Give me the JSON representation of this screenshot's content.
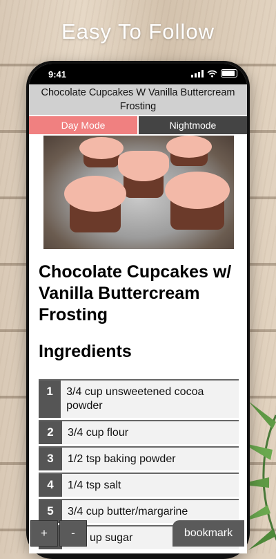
{
  "promo": {
    "headline": "Easy To Follow"
  },
  "status_bar": {
    "time": "9:41"
  },
  "app": {
    "title": "Chocolate Cupcakes W Vanilla Buttercream Frosting",
    "day_mode_label": "Day Mode",
    "night_mode_label": "Nightmode"
  },
  "recipe": {
    "title": "Chocolate Cupcakes w/ Vanilla Buttercream Frosting",
    "ingredients_heading": "Ingredients",
    "ingredients": [
      {
        "num": "1",
        "text": "3/4 cup unsweetened cocoa powder"
      },
      {
        "num": "2",
        "text": "3/4 cup flour"
      },
      {
        "num": "3",
        "text": "1/2 tsp baking powder"
      },
      {
        "num": "4",
        "text": "1/4 tsp salt"
      },
      {
        "num": "5",
        "text": "3/4 cup butter/margarine"
      },
      {
        "num": "6",
        "text": "up sugar"
      }
    ]
  },
  "controls": {
    "zoom_in_label": "+",
    "zoom_out_label": "-",
    "bookmark_label": "bookmark"
  },
  "colors": {
    "day_mode": "#f08080",
    "night_mode": "#444444",
    "title_bar": "#d0d0d0"
  },
  "icons": [
    "signal-icon",
    "wifi-icon",
    "battery-icon"
  ]
}
